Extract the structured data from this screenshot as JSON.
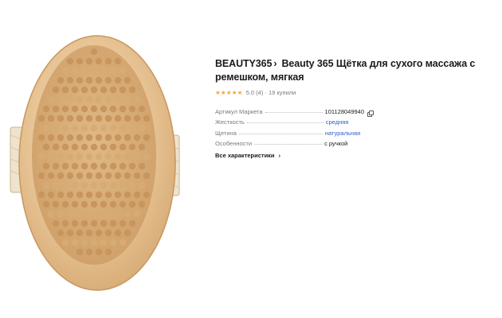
{
  "product": {
    "brand": "BEAUTY365",
    "title": "Beauty 365 Щётка для сухого массажа с ремешком, мягкая",
    "rating": "5.0",
    "rating_stars": "★★★★★",
    "reviews": "(4)",
    "separator": "·",
    "purchases": "19 купили",
    "image_alt": "Щётка для сухого массажа"
  },
  "specs": {
    "rows": [
      {
        "key": "Артикул Маркета",
        "value": "101128049940"
      },
      {
        "key": "Жесткость",
        "value": "средняя"
      },
      {
        "key": "Щетина",
        "value": "натуральная"
      },
      {
        "key": "Особенности",
        "value": "с ручкой"
      }
    ],
    "all_label": "Все характеристики"
  },
  "icons": {
    "brand_chevron": "chevron-right-icon",
    "copy": "copy-icon",
    "all_chevron": "chevron-right-icon",
    "star": "star-icon"
  },
  "colors": {
    "star": "#f1a93c",
    "link": "#2f5fd0",
    "muted": "#7a7a7a"
  }
}
